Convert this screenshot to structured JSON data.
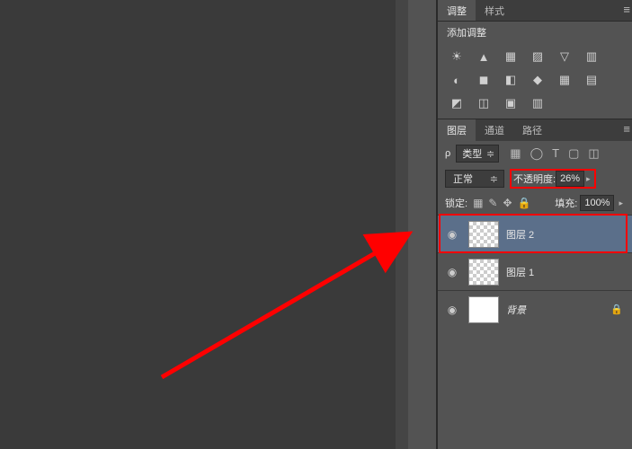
{
  "adjustments": {
    "tab_adjust": "调整",
    "tab_style": "样式",
    "title": "添加调整",
    "icons": [
      "☀",
      "▲",
      "▦",
      "▨",
      "▽",
      "▥",
      "◐",
      "◼",
      "◧",
      "◆",
      "▦",
      "▤",
      "◩",
      "◫",
      "▣",
      "▥"
    ]
  },
  "layers_panel": {
    "tab_layers": "图层",
    "tab_channels": "通道",
    "tab_paths": "路径",
    "kind_label": "类型",
    "filter_icons": [
      "▦",
      "◯",
      "T",
      "▢",
      "◫"
    ],
    "blend_mode": "正常",
    "opacity_label": "不透明度:",
    "opacity_value": "26%",
    "lock_label": "锁定:",
    "lock_icons": [
      "▦",
      "✎",
      "✥",
      "🔒"
    ],
    "fill_label": "填充:",
    "fill_value": "100%"
  },
  "layers": [
    {
      "name": "图层 2",
      "visible": true,
      "selected": true,
      "thumb": "checker"
    },
    {
      "name": "图层 1",
      "visible": true,
      "selected": false,
      "thumb": "checker"
    },
    {
      "name": "背景",
      "visible": true,
      "selected": false,
      "thumb": "white",
      "locked": true,
      "italic": true
    }
  ]
}
